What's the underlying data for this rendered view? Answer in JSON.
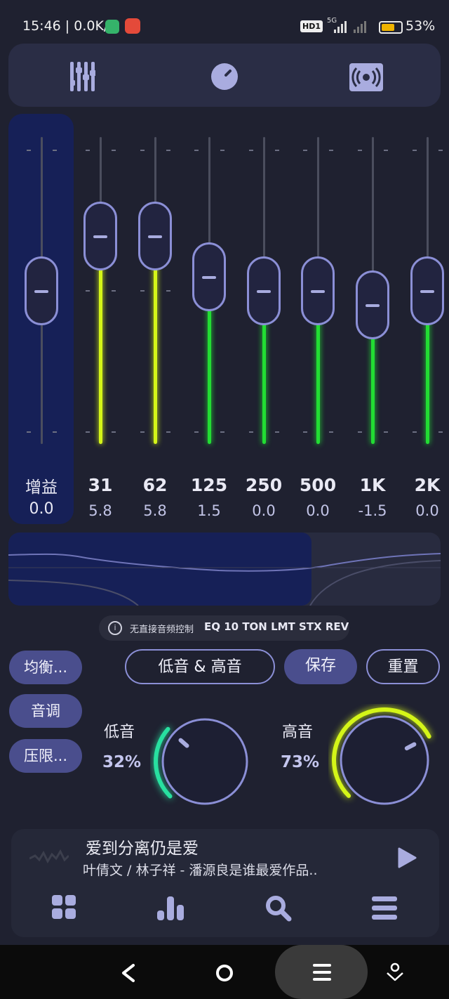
{
  "status_bar": {
    "time": "15:46 | 0.0K/s",
    "badge": "HD1",
    "network": "5G",
    "battery": "53%"
  },
  "tabs": [
    {
      "name": "equalizer",
      "icon": "equalizer-sliders-icon"
    },
    {
      "name": "tone",
      "icon": "knob-icon"
    },
    {
      "name": "surround",
      "icon": "speaker-wave-icon"
    }
  ],
  "gain": {
    "label": "增益",
    "value": "0.0"
  },
  "bands": [
    {
      "freq": "31",
      "value": "5.8",
      "level": 5.8
    },
    {
      "freq": "62",
      "value": "5.8",
      "level": 5.8
    },
    {
      "freq": "125",
      "value": "1.5",
      "level": 1.5
    },
    {
      "freq": "250",
      "value": "0.0",
      "level": 0.0
    },
    {
      "freq": "500",
      "value": "0.0",
      "level": 0.0
    },
    {
      "freq": "1K",
      "value": "-1.5",
      "level": -1.5
    },
    {
      "freq": "2K",
      "value": "0.0",
      "level": 0.0
    }
  ],
  "info": {
    "prefix": "无直接音频控制",
    "modes": "EQ 10 TON LMT STX REV"
  },
  "side_buttons": [
    "均衡...",
    "音调",
    "压限..."
  ],
  "actions": {
    "preset": "低音 & 高音",
    "save": "保存",
    "reset": "重置"
  },
  "bass": {
    "label": "低音",
    "percent": "32%",
    "level": 0.32
  },
  "treble": {
    "label": "高音",
    "percent": "73%",
    "level": 0.73
  },
  "player": {
    "title": "爱到分离仍是爱",
    "artist": "叶倩文 / 林子祥 - 潘源良是谁最爱作品.."
  },
  "colors": {
    "accent": "#8b8fd6",
    "green": "#22dd33",
    "lime": "#d4f518",
    "cyan": "#28e0a0"
  },
  "nav": [
    "back",
    "home",
    "menu",
    "assistant"
  ]
}
